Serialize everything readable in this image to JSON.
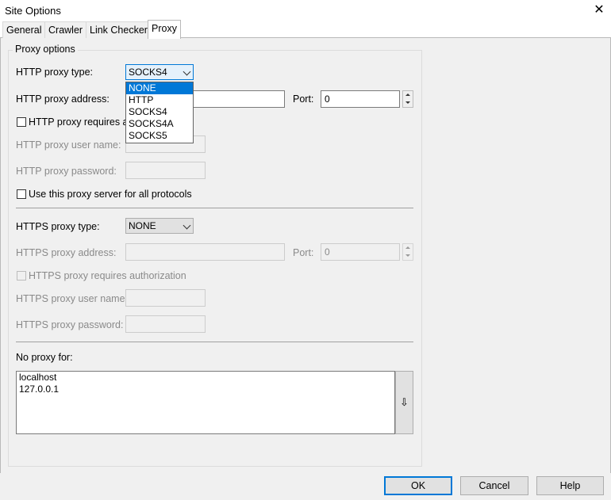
{
  "window": {
    "title": "Site Options",
    "close_glyph": "✕"
  },
  "tabs": [
    "General",
    "Crawler",
    "Link Checker",
    "Proxy"
  ],
  "proxy_group_label": "Proxy options",
  "http": {
    "type_label": "HTTP proxy type:",
    "type_value": "SOCKS4",
    "type_options": [
      "NONE",
      "HTTP",
      "SOCKS4",
      "SOCKS4A",
      "SOCKS5"
    ],
    "address_label": "HTTP proxy address:",
    "address_value": "",
    "port_label": "Port:",
    "port_value": "0",
    "auth_label": "HTTP proxy requires au",
    "user_label": "HTTP proxy user name:",
    "password_label": "HTTP proxy password:"
  },
  "use_all_label": "Use this proxy server for all protocols",
  "https": {
    "type_label": "HTTPS proxy type:",
    "type_value": "NONE",
    "address_label": "HTTPS proxy address:",
    "port_label": "Port:",
    "port_value": "0",
    "auth_label": "HTTPS proxy requires authorization",
    "user_label": "HTTPS proxy user name:",
    "password_label": "HTTPS proxy password:"
  },
  "no_proxy": {
    "label": "No proxy for:",
    "entries": [
      "localhost",
      "127.0.0.1"
    ],
    "button_glyph": "⇩"
  },
  "buttons": {
    "ok": "OK",
    "cancel": "Cancel",
    "help": "Help"
  }
}
